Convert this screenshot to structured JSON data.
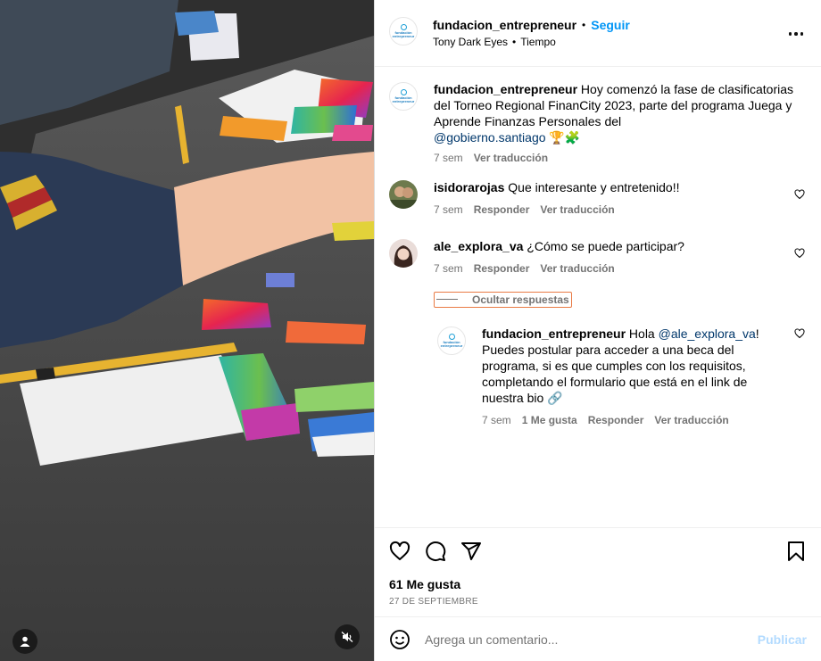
{
  "post": {
    "username": "fundacion_entrepreneur",
    "follow_label": "Seguir",
    "audio_artist": "Tony Dark Eyes",
    "audio_title": "Tiempo",
    "avatar_text_1": "fundación",
    "avatar_text_2": "entrepreneur"
  },
  "caption": {
    "username": "fundacion_entrepreneur",
    "text": "Hoy comenzó la fase de clasificatorias del Torneo Regional FinanCity 2023, parte del programa Juega y Aprende Finanzas Personales del",
    "mention": "@gobierno.santiago",
    "emoji": "🏆🧩",
    "time": "7 sem",
    "translate": "Ver traducción"
  },
  "comments": [
    {
      "username": "isidorarojas",
      "text": "Que interesante y entretenido!!",
      "time": "7 sem",
      "reply": "Responder",
      "translate": "Ver traducción"
    },
    {
      "username": "ale_explora_va",
      "text": "¿Cómo se puede participar?",
      "time": "7 sem",
      "reply": "Responder",
      "translate": "Ver traducción",
      "hide_replies": "Ocultar respuestas"
    }
  ],
  "reply": {
    "username": "fundacion_entrepreneur",
    "prefix": "Hola",
    "mention": "@ale_explora_va",
    "text": "! Puedes postular para acceder a una beca del programa, si es que cumples con los requisitos, completando el formulario que está en el link de nuestra bio",
    "emoji": "🔗",
    "time": "7 sem",
    "likes": "1 Me gusta",
    "reply": "Responder",
    "translate": "Ver traducción"
  },
  "footer": {
    "likes": "61 Me gusta",
    "date": "27 DE SEPTIEMBRE",
    "comment_placeholder": "Agrega un comentario...",
    "publish": "Publicar"
  },
  "icons": [
    "heart-icon",
    "comment-icon",
    "share-icon",
    "bookmark-icon",
    "emoji-icon",
    "more-icon",
    "user-tag-icon",
    "mute-icon"
  ]
}
